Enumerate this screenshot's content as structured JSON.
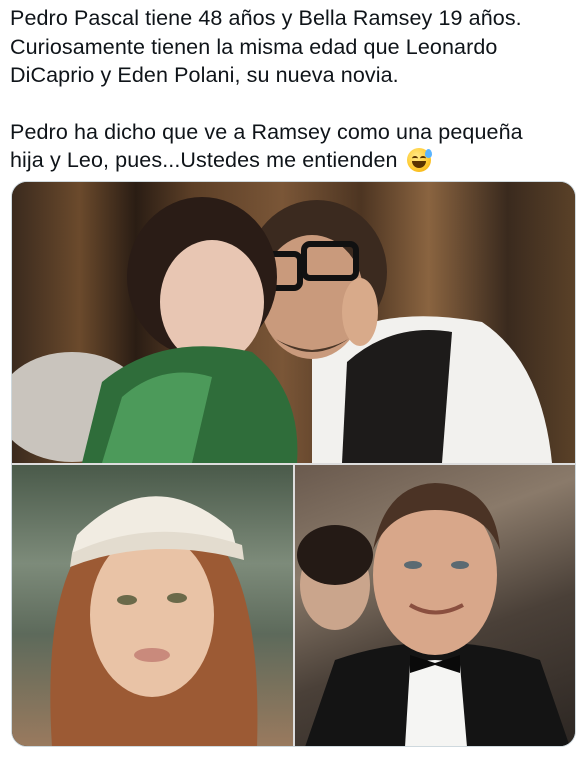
{
  "tweet": {
    "line1": "Pedro Pascal tiene 48 años y Bella Ramsey 19 años.",
    "line2": "Curiosamente tienen la misma edad que Leonardo",
    "line3": "DiCaprio y Eden Polani, su nueva novia.",
    "line4": "Pedro ha dicho que ve a Ramsey como una pequeña",
    "line5": "hija y Leo, pues...Ustedes me entienden",
    "emoji": "grinning-face-with-sweat-icon"
  },
  "media": {
    "photos": [
      {
        "name": "photo-pedro-pascal-bella-ramsey"
      },
      {
        "name": "photo-eden-polani"
      },
      {
        "name": "photo-leonardo-dicaprio"
      }
    ]
  }
}
